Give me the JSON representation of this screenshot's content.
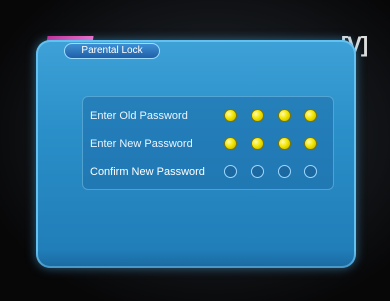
{
  "panel": {
    "title": "Parental Lock",
    "corner_mark": "[V]"
  },
  "rows": [
    {
      "label": "Enter Old Password",
      "digits": [
        "filled",
        "filled",
        "filled",
        "filled"
      ]
    },
    {
      "label": "Enter New Password",
      "digits": [
        "filled",
        "filled",
        "filled",
        "filled"
      ]
    },
    {
      "label": "Confirm New Password",
      "digits": [
        "empty",
        "empty",
        "empty",
        "empty"
      ]
    }
  ],
  "colors": {
    "panel": "#2a8fc8",
    "dot_filled": "#f2e600",
    "dot_empty_border": "#9fd8ff"
  }
}
